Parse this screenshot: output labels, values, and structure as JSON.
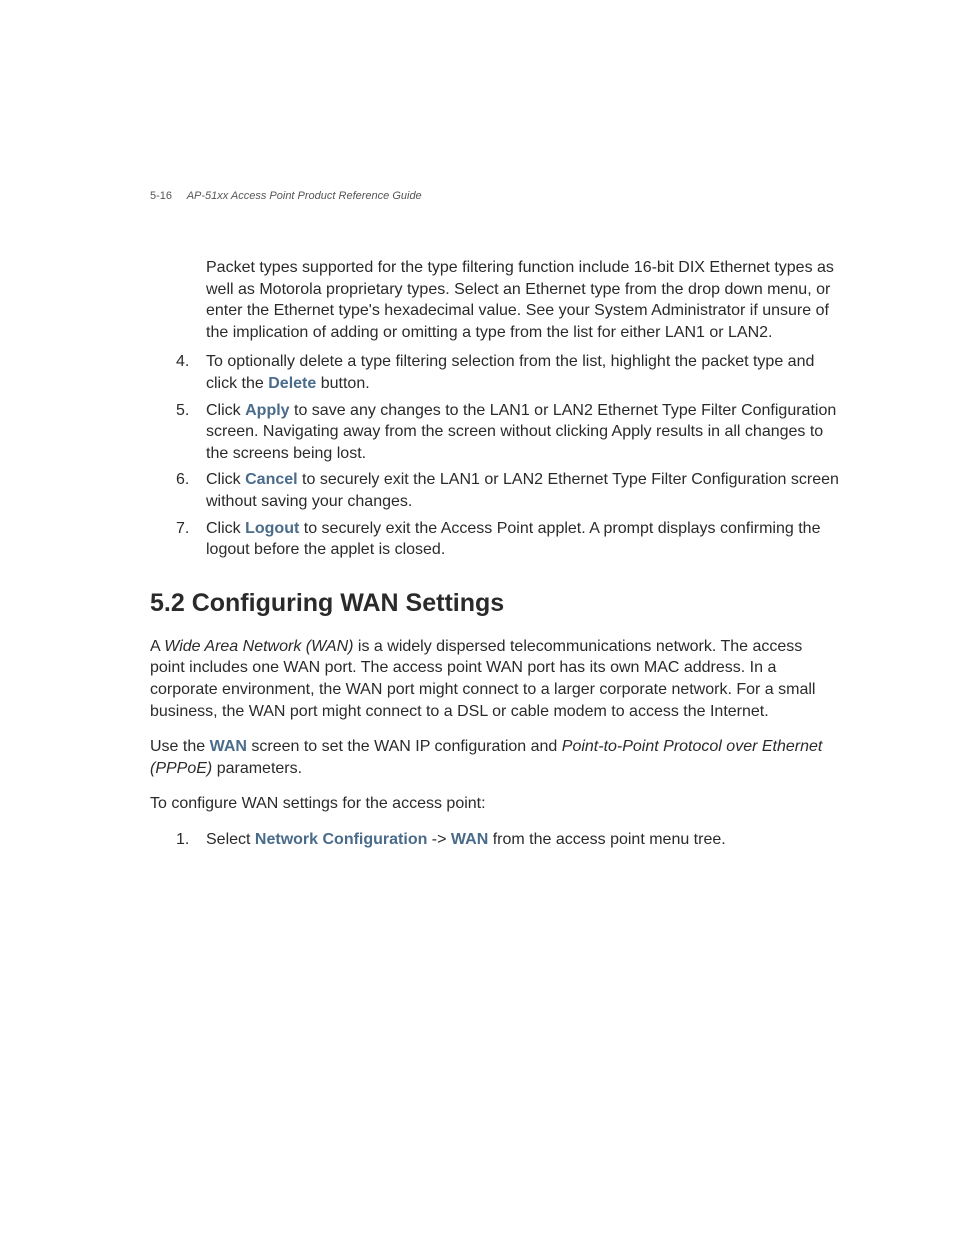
{
  "header": {
    "page_number": "5-16",
    "doc_title": "AP-51xx Access Point Product Reference Guide"
  },
  "preamble_paragraph": "Packet types supported for the type filtering function include 16-bit DIX Ethernet types as well as Motorola proprietary types. Select an Ethernet type from the drop down menu, or enter the Ethernet type's hexadecimal value. See your System Administrator if unsure of the implication of adding or omitting a type from the list for either LAN1 or LAN2.",
  "steps_a": {
    "4": {
      "pre": "To optionally delete a type filtering selection from the list, highlight the packet type and click the ",
      "kw": "Delete",
      "post": " button."
    },
    "5": {
      "pre": "Click ",
      "kw": "Apply",
      "post": " to save any changes to the LAN1 or LAN2 Ethernet Type Filter Configuration screen. Navigating away from the screen without clicking Apply results in all changes to the screens being lost."
    },
    "6": {
      "pre": "Click ",
      "kw": "Cancel",
      "post": " to securely exit the LAN1 or LAN2 Ethernet Type Filter Configuration screen without saving your changes."
    },
    "7": {
      "pre": "Click ",
      "kw": "Logout",
      "post": " to securely exit the Access Point applet. A prompt displays confirming the logout before the applet is closed."
    }
  },
  "section_heading": "5.2  Configuring WAN Settings",
  "wan_para1": {
    "pre": "A ",
    "ital": "Wide Area Network (WAN)",
    "post": " is a widely dispersed telecommunications network. The access point includes one WAN port. The access point WAN port has its own MAC address. In a corporate environment, the WAN port might connect to a larger corporate network. For a small business, the WAN port might connect to a DSL or cable modem to access the Internet."
  },
  "wan_para2": {
    "pre": "Use the ",
    "kw": "WAN",
    "mid": " screen to set the WAN IP configuration and ",
    "ital": "Point-to-Point Protocol over Ethernet (PPPoE)",
    "post": " parameters."
  },
  "wan_para3": "To configure WAN settings for the access point:",
  "steps_b": {
    "1": {
      "pre": "Select ",
      "kw1": "Network Configuration",
      "mid": " -> ",
      "kw2": "WAN",
      "post": " from the access point menu tree."
    }
  }
}
